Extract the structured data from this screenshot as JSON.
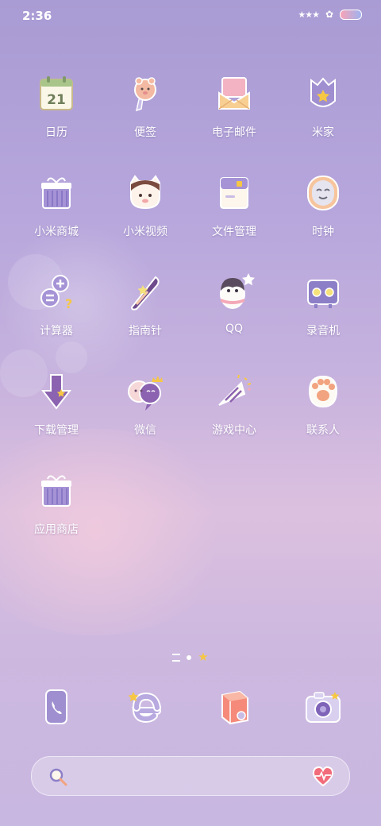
{
  "status_bar": {
    "time": "2:36"
  },
  "apps": [
    {
      "label": "日历",
      "icon": "calendar-icon",
      "date": "21"
    },
    {
      "label": "便签",
      "icon": "notes-icon"
    },
    {
      "label": "电子邮件",
      "icon": "email-icon"
    },
    {
      "label": "米家",
      "icon": "mijia-icon"
    },
    {
      "label": "小米商城",
      "icon": "mi-store-icon"
    },
    {
      "label": "小米视频",
      "icon": "mi-video-icon"
    },
    {
      "label": "文件管理",
      "icon": "file-manager-icon"
    },
    {
      "label": "时钟",
      "icon": "clock-icon"
    },
    {
      "label": "计算器",
      "icon": "calculator-icon"
    },
    {
      "label": "指南针",
      "icon": "compass-icon"
    },
    {
      "label": "QQ",
      "icon": "qq-penguin-icon"
    },
    {
      "label": "录音机",
      "icon": "recorder-icon"
    },
    {
      "label": "下载管理",
      "icon": "download-icon"
    },
    {
      "label": "微信",
      "icon": "wechat-icon"
    },
    {
      "label": "游戏中心",
      "icon": "game-center-icon"
    },
    {
      "label": "联系人",
      "icon": "contacts-icon"
    },
    {
      "label": "应用商店",
      "icon": "app-store-icon"
    }
  ],
  "dock": [
    {
      "icon": "phone-icon"
    },
    {
      "icon": "browser-icon"
    },
    {
      "icon": "themes-icon"
    },
    {
      "icon": "camera-icon"
    }
  ],
  "colors": {
    "label_text": "#ffffff",
    "accent_star": "#f6c744",
    "icon_lavender": "#9f8fd0",
    "icon_peach": "#f5c7a9"
  }
}
